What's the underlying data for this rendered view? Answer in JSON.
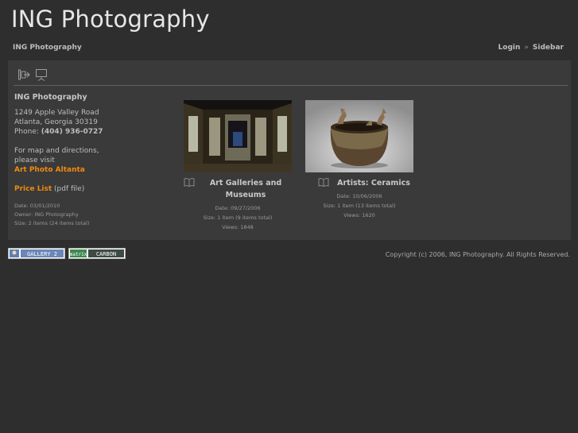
{
  "site": {
    "title": "ING Photography"
  },
  "nav": {
    "breadcrumb": "ING Photography",
    "login": "Login",
    "separator": "»",
    "sidebar": "Sidebar"
  },
  "toolbar": {
    "icons": [
      "exit-icon",
      "slideshow-icon"
    ]
  },
  "info": {
    "name": "ING Photography",
    "address1": "1249 Apple Valley Road",
    "address2": "Atlanta, Georgia 30319",
    "phone_label": "Phone:",
    "phone": "(404) 936-0727",
    "directions1": "For map and directions,",
    "directions2": "please visit",
    "directions_link": "Art Photo Altanta",
    "price_link": "Price List",
    "price_note": "(pdf file)",
    "date": "Date: 03/01/2010",
    "owner": "Owner: ING Photography",
    "size": "Size: 2 items (24 items total)"
  },
  "albums": [
    {
      "title_line1": "Art Galleries and",
      "title_line2": "Museums",
      "date": "Date: 09/27/2006",
      "size": "Size: 1 item (9 items total)",
      "views": "Views: 1848"
    },
    {
      "title_line1": "Artists: Ceramics",
      "title_line2": "",
      "date": "Date: 10/06/2006",
      "size": "Size: 1 item (13 items total)",
      "views": "Views: 1620"
    }
  ],
  "badges": {
    "gallery": "GALLERY 2",
    "matrix": "matrix",
    "carbon": "CARBON"
  },
  "footer": {
    "copyright": "Copyright (c) 2006, ING Photography. All Rights Reserved."
  },
  "colors": {
    "background": "#2e2e2e",
    "panel": "#3a3a3a",
    "accent": "#ef8a10"
  }
}
